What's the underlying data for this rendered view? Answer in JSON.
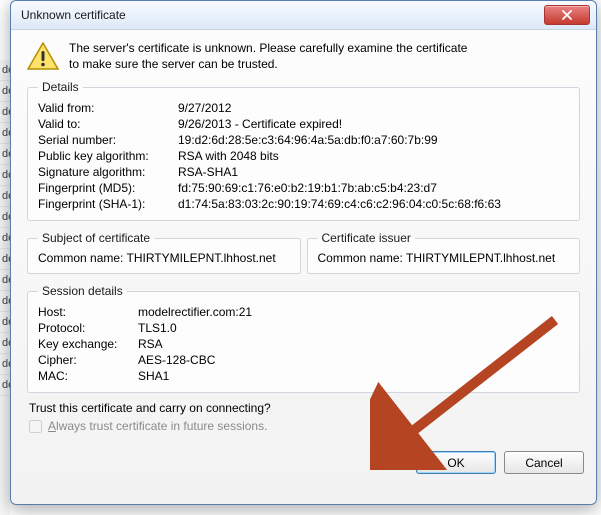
{
  "window": {
    "title": "Unknown certificate",
    "close_tooltip": "Close"
  },
  "message": {
    "line1": "The server's certificate is unknown. Please carefully examine the certificate",
    "line2": "to make sure the server can be trusted."
  },
  "details": {
    "legend": "Details",
    "rows": {
      "valid_from_k": "Valid from:",
      "valid_from_v": "9/27/2012",
      "valid_to_k": "Valid to:",
      "valid_to_v": "9/26/2013 - Certificate expired!",
      "serial_k": "Serial number:",
      "serial_v": "19:d2:6d:28:5e:c3:64:96:4a:5a:db:f0:a7:60:7b:99",
      "pka_k": "Public key algorithm:",
      "pka_v": "RSA with 2048 bits",
      "sigalg_k": "Signature algorithm:",
      "sigalg_v": "RSA-SHA1",
      "fp_md5_k": "Fingerprint (MD5):",
      "fp_md5_v": "fd:75:90:69:c1:76:e0:b2:19:b1:7b:ab:c5:b4:23:d7",
      "fp_sha1_k": "Fingerprint (SHA-1):",
      "fp_sha1_v": "d1:74:5a:83:03:2c:90:19:74:69:c4:c6:c2:96:04:c0:5c:68:f6:63"
    }
  },
  "subject": {
    "legend": "Subject of certificate",
    "cn_k": "Common name:",
    "cn_v": "THIRTYMILEPNT.lhhost.net"
  },
  "issuer": {
    "legend": "Certificate issuer",
    "cn_k": "Common name:",
    "cn_v": "THIRTYMILEPNT.lhhost.net"
  },
  "session": {
    "legend": "Session details",
    "host_k": "Host:",
    "host_v": "modelrectifier.com:21",
    "proto_k": "Protocol:",
    "proto_v": "TLS1.0",
    "kex_k": "Key exchange:",
    "kex_v": "RSA",
    "cipher_k": "Cipher:",
    "cipher_v": "AES-128-CBC",
    "mac_k": "MAC:",
    "mac_v": "SHA1"
  },
  "trust": {
    "question": "Trust this certificate and carry on connecting?",
    "always_label_pre": "A",
    "always_label_rest": "lways trust certificate in future sessions."
  },
  "buttons": {
    "ok": "OK",
    "cancel": "Cancel"
  },
  "bg_text": "de"
}
